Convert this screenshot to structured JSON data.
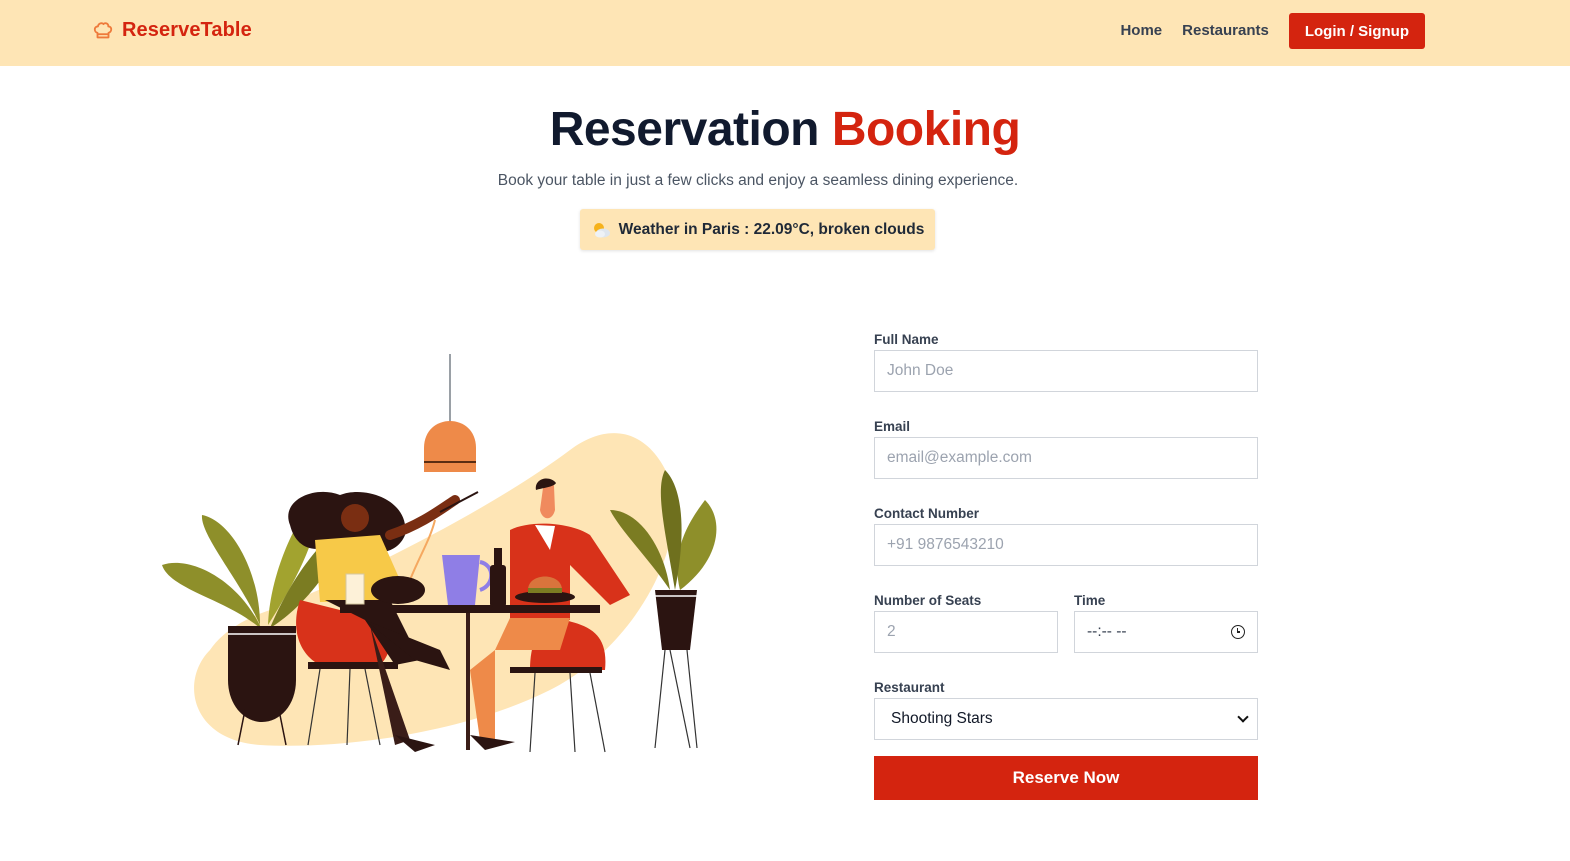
{
  "brand": {
    "name": "ReserveTable",
    "icon": "chef-hat-icon",
    "color": "#d4240f"
  },
  "nav": {
    "home": "Home",
    "restaurants": "Restaurants",
    "login": "Login / Signup"
  },
  "hero": {
    "title_main": "Reservation",
    "title_accent": "Booking",
    "subtitle": "Book your table in just a few clicks and enjoy a seamless dining experience.",
    "weather_text": "Weather in Paris : 22.09°C, broken clouds",
    "weather_icon": "partly-cloudy-icon"
  },
  "form": {
    "full_name": {
      "label": "Full Name",
      "placeholder": "John Doe"
    },
    "email": {
      "label": "Email",
      "placeholder": "email@example.com"
    },
    "contact": {
      "label": "Contact Number",
      "placeholder": "+91 9876543210"
    },
    "seats": {
      "label": "Number of Seats",
      "placeholder": "2"
    },
    "time": {
      "label": "Time",
      "value": "--:-- --"
    },
    "restaurant": {
      "label": "Restaurant",
      "selected": "Shooting Stars"
    },
    "submit": "Reserve Now"
  },
  "colors": {
    "accent": "#d4240f",
    "header_bg": "#fee5b5",
    "title_dark": "#111a2e"
  }
}
